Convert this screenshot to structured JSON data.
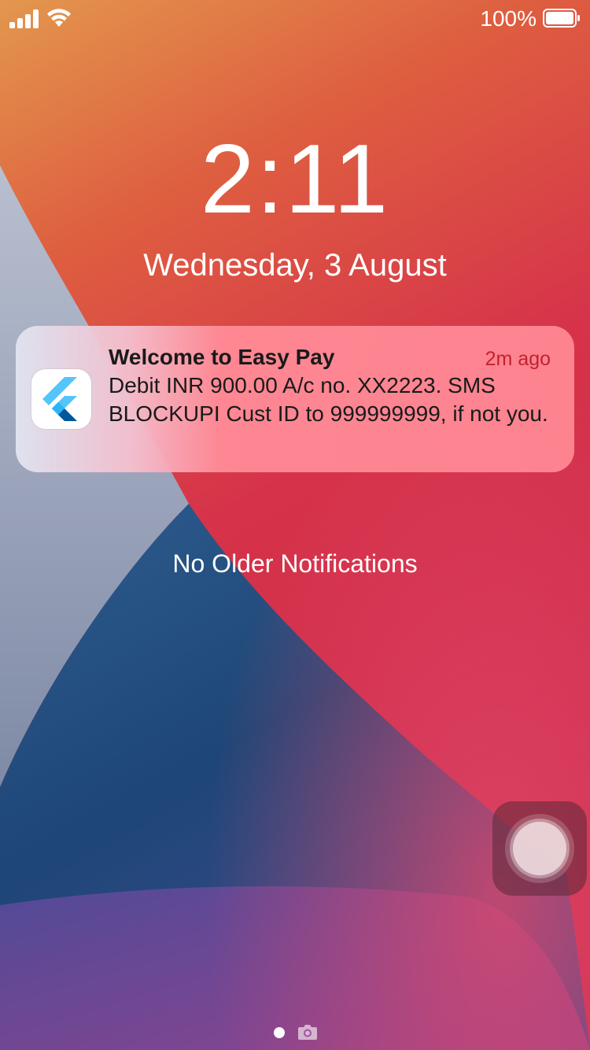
{
  "status_bar": {
    "battery_percent": "100%",
    "signal_icon": "cellular-signal-icon",
    "wifi_icon": "wifi-icon",
    "battery_icon": "battery-icon"
  },
  "lock_screen": {
    "time": "2:11",
    "date": "Wednesday, 3 August"
  },
  "notification": {
    "app_icon": "flutter-logo-icon",
    "title": "Welcome to Easy Pay",
    "time_ago": "2m ago",
    "body": "Debit INR 900.00 A/c no. XX2223. SMS BLOCKUPI Cust ID to 999999999, if not you."
  },
  "no_older_notifications": "No Older Notifications",
  "assistive_touch": {
    "icon": "assistive-touch-icon"
  },
  "page_indicator": {
    "icons": [
      "page-dot-icon",
      "camera-icon"
    ]
  },
  "colors": {
    "notification_time": "#c2222f",
    "wallpaper_red": "#d3304a",
    "wallpaper_blue": "#1f4d7c",
    "wallpaper_orange": "#e0804a"
  }
}
